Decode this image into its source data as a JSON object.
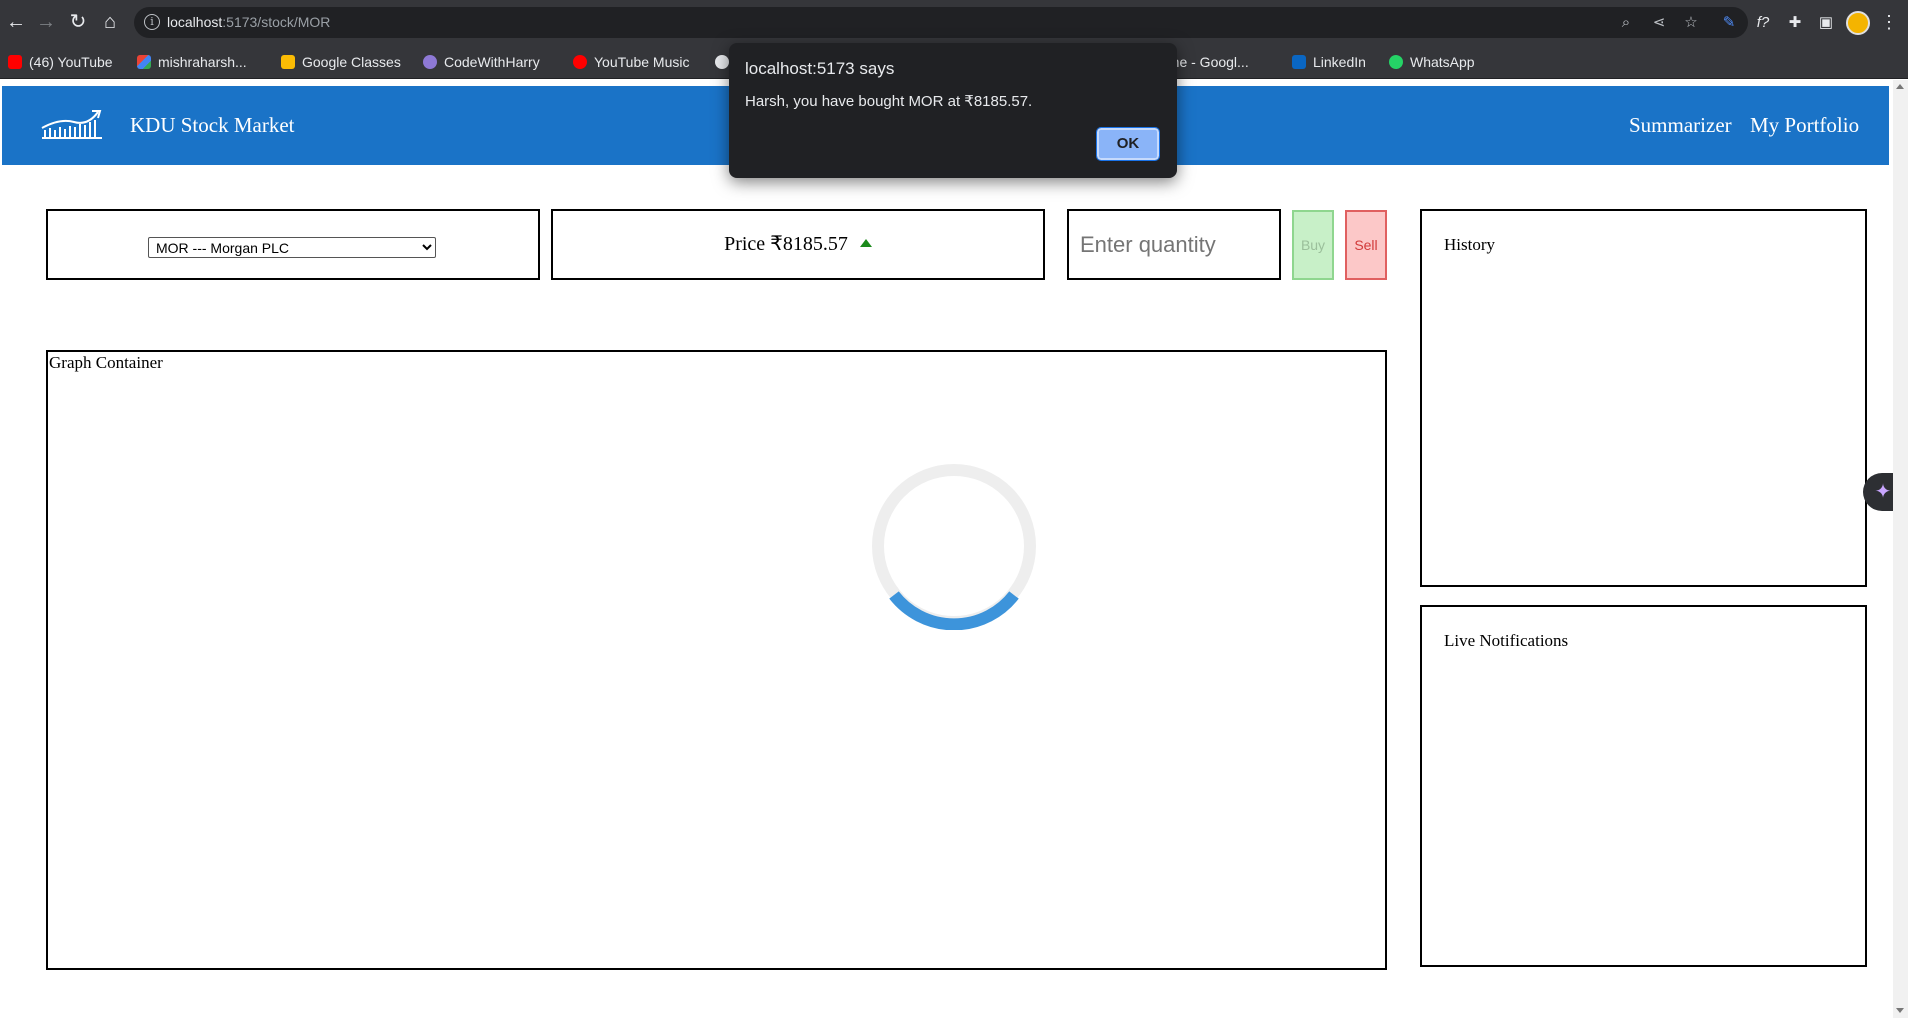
{
  "browser": {
    "url_host": "localhost",
    "url_rest": ":5173/stock/MOR",
    "bookmarks": [
      {
        "label": "(46) YouTube",
        "icon": "youtube-icon"
      },
      {
        "label": "mishraharsh...",
        "icon": "gmail-icon"
      },
      {
        "label": "Google Classes",
        "icon": "google-classroom-icon"
      },
      {
        "label": "CodeWithHarry",
        "icon": "codewithharry-icon"
      },
      {
        "label": "YouTube Music",
        "icon": "youtube-music-icon"
      },
      {
        "label": "",
        "icon": "github-icon"
      },
      {
        "label": "ome - Googl...",
        "icon": "google-icon"
      },
      {
        "label": "LinkedIn",
        "icon": "linkedin-icon"
      },
      {
        "label": "WhatsApp",
        "icon": "whatsapp-icon"
      }
    ]
  },
  "header": {
    "brand": "KDU Stock Market",
    "nav": [
      "Summarizer",
      "My Portfolio"
    ]
  },
  "controls": {
    "stock_selected": "MOR --- Morgan PLC",
    "price_label": "Price ₹8185.57",
    "price_trend": "up",
    "quantity_placeholder": "Enter quantity",
    "buy_label": "Buy",
    "sell_label": "Sell"
  },
  "panels": {
    "graph_title": "Graph Container",
    "history_title": "History",
    "notifications_title": "Live Notifications"
  },
  "dialog": {
    "title": "localhost:5173 says",
    "message": "Harsh, you have bought MOR at ₹8185.57.",
    "ok_label": "OK"
  },
  "colors": {
    "header_bg": "#1a73c7",
    "buy_bg": "#c8f0c8",
    "sell_bg": "#fcc8c8",
    "price_up": "#1b8a1b",
    "spinner": "#3d94db"
  }
}
